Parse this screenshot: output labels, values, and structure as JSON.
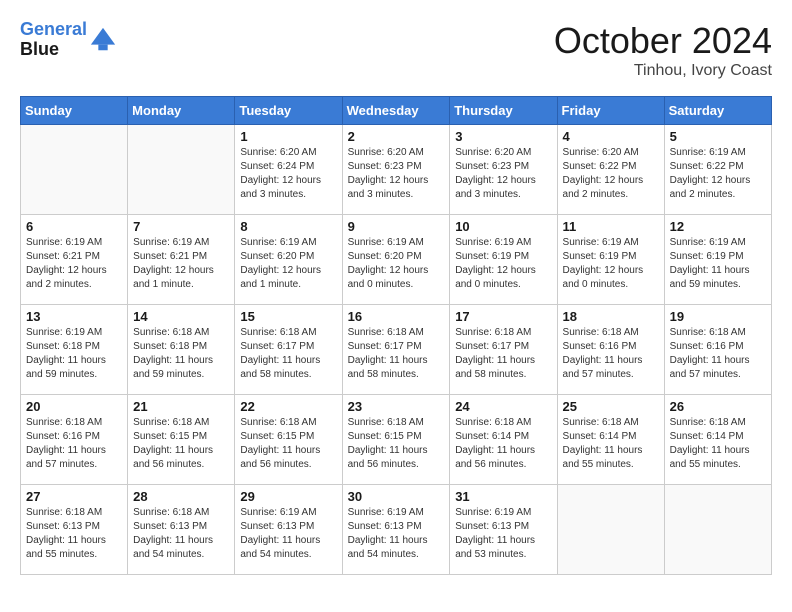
{
  "header": {
    "logo_line1": "General",
    "logo_line2": "Blue",
    "month_title": "October 2024",
    "location": "Tinhou, Ivory Coast"
  },
  "days_of_week": [
    "Sunday",
    "Monday",
    "Tuesday",
    "Wednesday",
    "Thursday",
    "Friday",
    "Saturday"
  ],
  "weeks": [
    [
      {
        "day": "",
        "info": ""
      },
      {
        "day": "",
        "info": ""
      },
      {
        "day": "1",
        "info": "Sunrise: 6:20 AM\nSunset: 6:24 PM\nDaylight: 12 hours and 3 minutes."
      },
      {
        "day": "2",
        "info": "Sunrise: 6:20 AM\nSunset: 6:23 PM\nDaylight: 12 hours and 3 minutes."
      },
      {
        "day": "3",
        "info": "Sunrise: 6:20 AM\nSunset: 6:23 PM\nDaylight: 12 hours and 3 minutes."
      },
      {
        "day": "4",
        "info": "Sunrise: 6:20 AM\nSunset: 6:22 PM\nDaylight: 12 hours and 2 minutes."
      },
      {
        "day": "5",
        "info": "Sunrise: 6:19 AM\nSunset: 6:22 PM\nDaylight: 12 hours and 2 minutes."
      }
    ],
    [
      {
        "day": "6",
        "info": "Sunrise: 6:19 AM\nSunset: 6:21 PM\nDaylight: 12 hours and 2 minutes."
      },
      {
        "day": "7",
        "info": "Sunrise: 6:19 AM\nSunset: 6:21 PM\nDaylight: 12 hours and 1 minute."
      },
      {
        "day": "8",
        "info": "Sunrise: 6:19 AM\nSunset: 6:20 PM\nDaylight: 12 hours and 1 minute."
      },
      {
        "day": "9",
        "info": "Sunrise: 6:19 AM\nSunset: 6:20 PM\nDaylight: 12 hours and 0 minutes."
      },
      {
        "day": "10",
        "info": "Sunrise: 6:19 AM\nSunset: 6:19 PM\nDaylight: 12 hours and 0 minutes."
      },
      {
        "day": "11",
        "info": "Sunrise: 6:19 AM\nSunset: 6:19 PM\nDaylight: 12 hours and 0 minutes."
      },
      {
        "day": "12",
        "info": "Sunrise: 6:19 AM\nSunset: 6:19 PM\nDaylight: 11 hours and 59 minutes."
      }
    ],
    [
      {
        "day": "13",
        "info": "Sunrise: 6:19 AM\nSunset: 6:18 PM\nDaylight: 11 hours and 59 minutes."
      },
      {
        "day": "14",
        "info": "Sunrise: 6:18 AM\nSunset: 6:18 PM\nDaylight: 11 hours and 59 minutes."
      },
      {
        "day": "15",
        "info": "Sunrise: 6:18 AM\nSunset: 6:17 PM\nDaylight: 11 hours and 58 minutes."
      },
      {
        "day": "16",
        "info": "Sunrise: 6:18 AM\nSunset: 6:17 PM\nDaylight: 11 hours and 58 minutes."
      },
      {
        "day": "17",
        "info": "Sunrise: 6:18 AM\nSunset: 6:17 PM\nDaylight: 11 hours and 58 minutes."
      },
      {
        "day": "18",
        "info": "Sunrise: 6:18 AM\nSunset: 6:16 PM\nDaylight: 11 hours and 57 minutes."
      },
      {
        "day": "19",
        "info": "Sunrise: 6:18 AM\nSunset: 6:16 PM\nDaylight: 11 hours and 57 minutes."
      }
    ],
    [
      {
        "day": "20",
        "info": "Sunrise: 6:18 AM\nSunset: 6:16 PM\nDaylight: 11 hours and 57 minutes."
      },
      {
        "day": "21",
        "info": "Sunrise: 6:18 AM\nSunset: 6:15 PM\nDaylight: 11 hours and 56 minutes."
      },
      {
        "day": "22",
        "info": "Sunrise: 6:18 AM\nSunset: 6:15 PM\nDaylight: 11 hours and 56 minutes."
      },
      {
        "day": "23",
        "info": "Sunrise: 6:18 AM\nSunset: 6:15 PM\nDaylight: 11 hours and 56 minutes."
      },
      {
        "day": "24",
        "info": "Sunrise: 6:18 AM\nSunset: 6:14 PM\nDaylight: 11 hours and 56 minutes."
      },
      {
        "day": "25",
        "info": "Sunrise: 6:18 AM\nSunset: 6:14 PM\nDaylight: 11 hours and 55 minutes."
      },
      {
        "day": "26",
        "info": "Sunrise: 6:18 AM\nSunset: 6:14 PM\nDaylight: 11 hours and 55 minutes."
      }
    ],
    [
      {
        "day": "27",
        "info": "Sunrise: 6:18 AM\nSunset: 6:13 PM\nDaylight: 11 hours and 55 minutes."
      },
      {
        "day": "28",
        "info": "Sunrise: 6:18 AM\nSunset: 6:13 PM\nDaylight: 11 hours and 54 minutes."
      },
      {
        "day": "29",
        "info": "Sunrise: 6:19 AM\nSunset: 6:13 PM\nDaylight: 11 hours and 54 minutes."
      },
      {
        "day": "30",
        "info": "Sunrise: 6:19 AM\nSunset: 6:13 PM\nDaylight: 11 hours and 54 minutes."
      },
      {
        "day": "31",
        "info": "Sunrise: 6:19 AM\nSunset: 6:13 PM\nDaylight: 11 hours and 53 minutes."
      },
      {
        "day": "",
        "info": ""
      },
      {
        "day": "",
        "info": ""
      }
    ]
  ]
}
